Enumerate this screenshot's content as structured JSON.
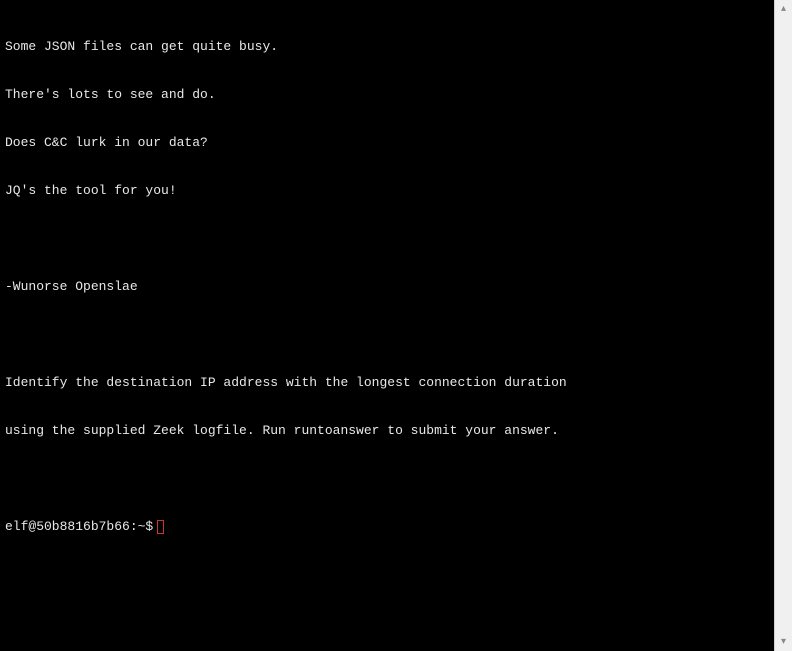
{
  "terminal": {
    "lines": [
      "Some JSON files can get quite busy.",
      "There's lots to see and do.",
      "Does C&C lurk in our data?",
      "JQ's the tool for you!",
      "",
      "-Wunorse Openslae",
      "",
      "Identify the destination IP address with the longest connection duration",
      "using the supplied Zeek logfile. Run runtoanswer to submit your answer.",
      ""
    ],
    "prompt": "elf@50b8816b7b66:~$"
  },
  "scrollbar": {
    "up_glyph": "▴",
    "down_glyph": "▾"
  }
}
